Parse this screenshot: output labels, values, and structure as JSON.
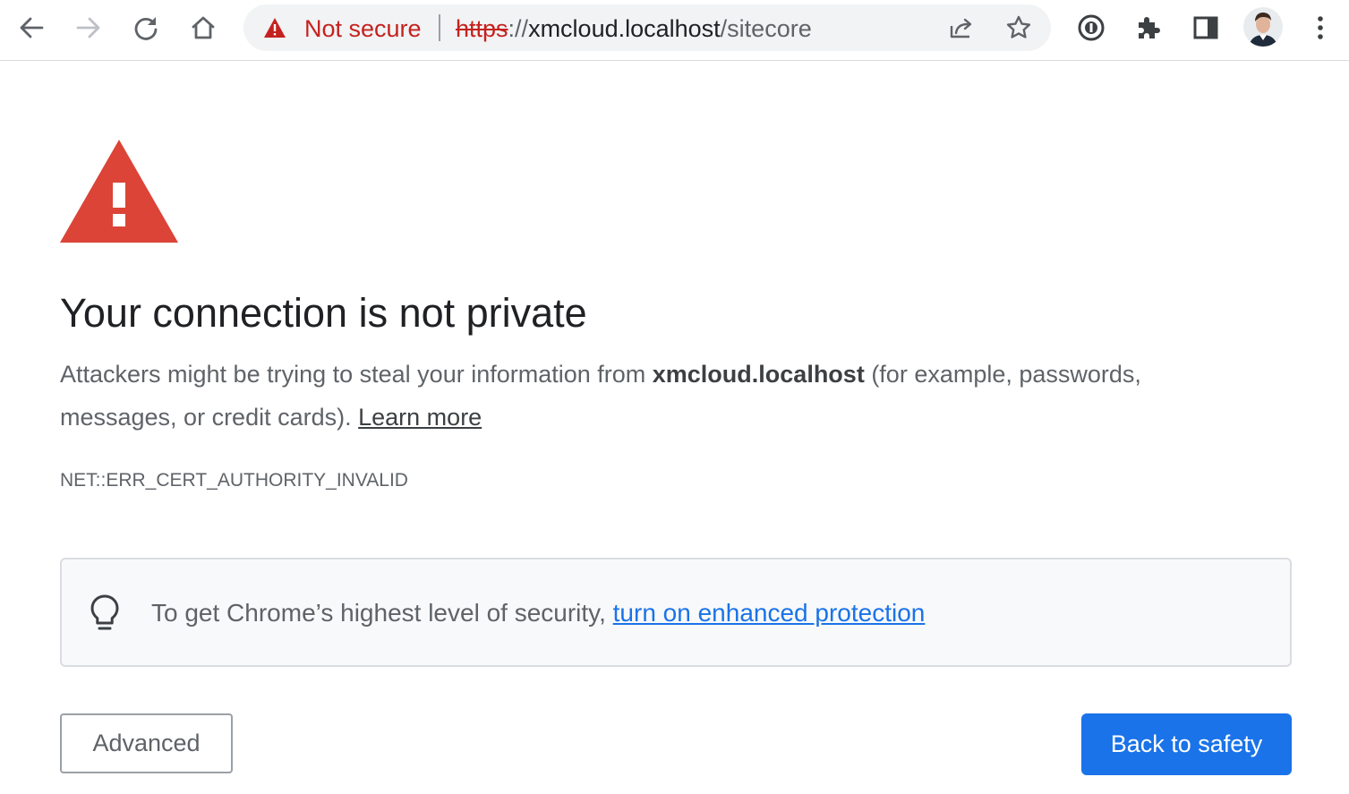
{
  "toolbar": {
    "back_icon": "arrow-back-icon",
    "forward_icon": "arrow-forward-icon",
    "reload_icon": "reload-icon",
    "home_icon": "home-icon",
    "security_status": "Not secure",
    "url": {
      "scheme": "https",
      "separator": "://",
      "host": "xmcloud.localhost",
      "path": "/sitecore"
    },
    "share_icon": "share-icon",
    "bookmark_icon": "star-icon",
    "extension_icons": [
      "password-manager-icon",
      "puzzle-extensions-icon",
      "side-panel-icon"
    ],
    "menu_icon": "kebab-menu-icon"
  },
  "interstitial": {
    "heading": "Your connection is not private",
    "explanation_pre": "Attackers might be trying to steal your information from ",
    "explanation_host": "xmcloud.localhost",
    "explanation_post": " (for example, passwords, messages, or credit cards). ",
    "learn_more": "Learn more",
    "error_code": "NET::ERR_CERT_AUTHORITY_INVALID",
    "promo_text": "To get Chrome’s highest level of security, ",
    "promo_link": "turn on enhanced protection",
    "advanced_button": "Advanced",
    "back_button": "Back to safety"
  },
  "colors": {
    "danger": "#c5221f",
    "warning_triangle": "#db4437",
    "primary_blue": "#1a73e8",
    "omnibox_bg": "#f1f3f4",
    "promo_bg": "#f8f9fa"
  }
}
